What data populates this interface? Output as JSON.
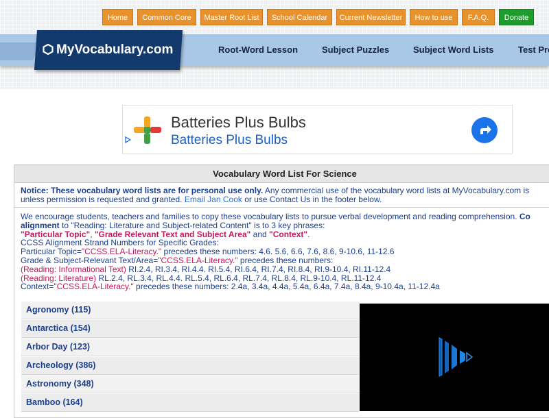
{
  "top_nav": [
    {
      "label": "Home"
    },
    {
      "label": "Common Core"
    },
    {
      "label": "Master Root List"
    },
    {
      "label": "School Calendar"
    },
    {
      "label": "Current Newsletter"
    },
    {
      "label": "How to use"
    },
    {
      "label": "F.A.Q."
    },
    {
      "label": "Donate"
    }
  ],
  "logo": {
    "text": "MyVocabulary.com"
  },
  "main_nav": [
    {
      "label": "Root-Word Lesson"
    },
    {
      "label": "Subject Puzzles"
    },
    {
      "label": "Subject Word Lists"
    },
    {
      "label": "Test Pre"
    }
  ],
  "ad": {
    "title": "Batteries Plus Bulbs",
    "subtitle": "Batteries Plus Bulbs"
  },
  "content": {
    "title": "Vocabulary Word List For Science",
    "notice_bold": "Notice: These vocabulary word lists are for personal use only.",
    "notice_rest": " Any commercial use of the vocabulary word lists at MyVocabulary.com is",
    "notice_line2_a": "unless permission is requested and granted.",
    "notice_link": "Email Jan Cook",
    "notice_line2_b": " or use Contact Us in the footer below.",
    "enc_line1": "We encourage students, teachers and families to copy these vocabulary lists to pursue verbal development and reading comprehension. ",
    "enc_line1_bold": "Co",
    "alignment_bold": "alignment",
    "alignment_rest": " to \"Reading: Literature and Subject-related Content\" is to 3 key phrases:",
    "phrase1": "\"Particular Topic\"",
    "comma": ", ",
    "phrase2": "\"Grade Relevant Text and Subject Area\"",
    "and": " and ",
    "phrase3": "\"Context\"",
    "period": ".",
    "ccss_heading": "CCSS Alignment Strand Numbers for Specific Grades:",
    "pt_a": "Particular Topic=",
    "pt_pink": "\"CCSS.ELA-Literacy.\"",
    "pt_b": " precedes these numbers: 4.6. 5.6, 6.6, 7.6, 8.6, 9-10.6, 11-12.6",
    "gs_a": "Grade & Subject-Relevant Text/Area=",
    "gs_pink": "\"CCSS.ELA-Literacy.\"",
    "gs_b": " precedes these numbers:",
    "ri_pink": "(Reading: Informational Text)",
    "ri_rest": " RI.2.4, RI.3.4, RI.4.4. RI.5.4, RI.6.4, RI.7.4, RI.8.4, RI.9-10.4, RI.11-12.4",
    "rl_pink": "(Reading: Literature)",
    "rl_rest": " RL.2.4, RL.3.4, RL.4.4. RL.5.4, RL.6.4, RL.7.4, RL.8.4, RL.9-10.4, RL.11-12.4",
    "ctx_a": "Context=",
    "ctx_pink": "\"CCSS.ELA-Literacy.\"",
    "ctx_b": " precedes these numbers: 2.4a, 3.4a, 4.4a, 5.4a, 6.4a, 7.4a, 8.4a, 9-10.4a, 11-12.4a"
  },
  "word_lists": [
    {
      "label": "Agronomy (115)"
    },
    {
      "label": "Antarctica (154)"
    },
    {
      "label": "Arbor Day (123)"
    },
    {
      "label": "Archeology (386)"
    },
    {
      "label": "Astronomy (348)"
    },
    {
      "label": "Bamboo (164)"
    }
  ],
  "colors": {
    "nav_orange": "#e8922e",
    "donate_green": "#1f9d2c",
    "logo_navy": "#123a6d",
    "nav_blue": "#a9c7e6",
    "text_blue": "#1b3f8f",
    "highlight_pink": "#c2185b"
  },
  "icons": {
    "logo": "hexagon-icon",
    "ad": "plus-cross-icon",
    "ad_action": "arrow-turn-icon",
    "video": "video-player-icon"
  }
}
